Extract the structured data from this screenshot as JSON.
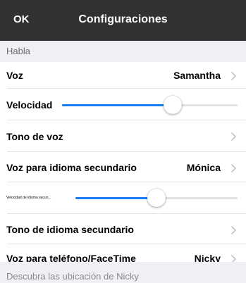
{
  "navbar": {
    "ok_label": "OK",
    "title": "Configuraciones"
  },
  "sections": [
    {
      "header": "Habla"
    },
    {
      "header": "Descubra las ubicación de Nicky"
    }
  ],
  "rows": {
    "voice": {
      "label": "Voz",
      "value": "Samantha",
      "chevron_icon": "chevron-right-icon"
    },
    "rate": {
      "label": "Velocidad",
      "level": 0.63
    },
    "pitch": {
      "label": "Tono de voz",
      "chevron_icon": "chevron-right-icon"
    },
    "secondary_voice": {
      "label": "Voz para idioma secundario",
      "value": "Mónica",
      "chevron_icon": "chevron-right-icon"
    },
    "secondary_rate": {
      "label": "Velocidad de idioma secun...",
      "level": 0.5
    },
    "secondary_pitch": {
      "label": "Tono de idioma secundario",
      "chevron_icon": "chevron-right-icon"
    },
    "facetime_voice": {
      "label": "Voz para teléfono/FaceTime",
      "value": "Nicky",
      "chevron_icon": "chevron-right-icon"
    }
  },
  "colors": {
    "navbar_bg": "#313131",
    "accent": "#1a7cf6",
    "section_bg": "#efeff4"
  }
}
